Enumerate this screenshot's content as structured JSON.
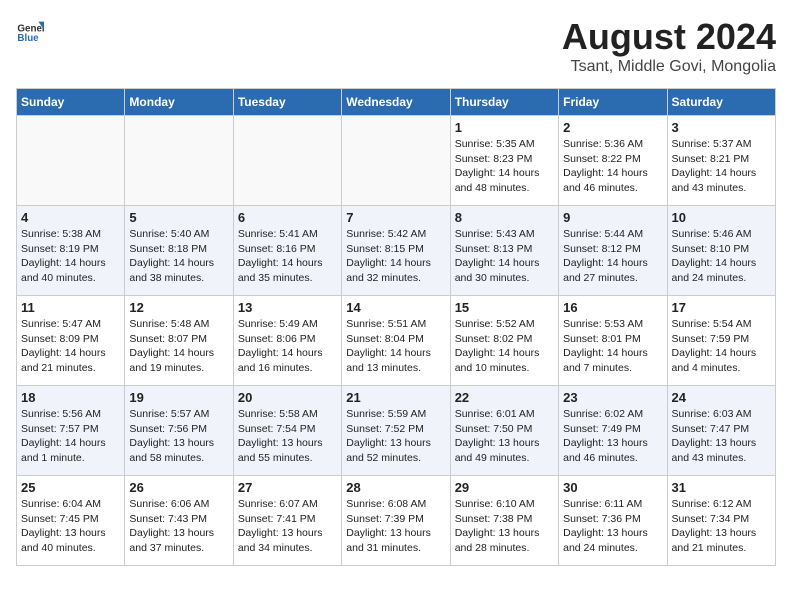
{
  "header": {
    "logo_general": "General",
    "logo_blue": "Blue",
    "month_title": "August 2024",
    "location": "Tsant, Middle Govi, Mongolia"
  },
  "days_of_week": [
    "Sunday",
    "Monday",
    "Tuesday",
    "Wednesday",
    "Thursday",
    "Friday",
    "Saturday"
  ],
  "weeks": [
    [
      {
        "day": "",
        "info": ""
      },
      {
        "day": "",
        "info": ""
      },
      {
        "day": "",
        "info": ""
      },
      {
        "day": "",
        "info": ""
      },
      {
        "day": "1",
        "info": "Sunrise: 5:35 AM\nSunset: 8:23 PM\nDaylight: 14 hours and 48 minutes."
      },
      {
        "day": "2",
        "info": "Sunrise: 5:36 AM\nSunset: 8:22 PM\nDaylight: 14 hours and 46 minutes."
      },
      {
        "day": "3",
        "info": "Sunrise: 5:37 AM\nSunset: 8:21 PM\nDaylight: 14 hours and 43 minutes."
      }
    ],
    [
      {
        "day": "4",
        "info": "Sunrise: 5:38 AM\nSunset: 8:19 PM\nDaylight: 14 hours and 40 minutes."
      },
      {
        "day": "5",
        "info": "Sunrise: 5:40 AM\nSunset: 8:18 PM\nDaylight: 14 hours and 38 minutes."
      },
      {
        "day": "6",
        "info": "Sunrise: 5:41 AM\nSunset: 8:16 PM\nDaylight: 14 hours and 35 minutes."
      },
      {
        "day": "7",
        "info": "Sunrise: 5:42 AM\nSunset: 8:15 PM\nDaylight: 14 hours and 32 minutes."
      },
      {
        "day": "8",
        "info": "Sunrise: 5:43 AM\nSunset: 8:13 PM\nDaylight: 14 hours and 30 minutes."
      },
      {
        "day": "9",
        "info": "Sunrise: 5:44 AM\nSunset: 8:12 PM\nDaylight: 14 hours and 27 minutes."
      },
      {
        "day": "10",
        "info": "Sunrise: 5:46 AM\nSunset: 8:10 PM\nDaylight: 14 hours and 24 minutes."
      }
    ],
    [
      {
        "day": "11",
        "info": "Sunrise: 5:47 AM\nSunset: 8:09 PM\nDaylight: 14 hours and 21 minutes."
      },
      {
        "day": "12",
        "info": "Sunrise: 5:48 AM\nSunset: 8:07 PM\nDaylight: 14 hours and 19 minutes."
      },
      {
        "day": "13",
        "info": "Sunrise: 5:49 AM\nSunset: 8:06 PM\nDaylight: 14 hours and 16 minutes."
      },
      {
        "day": "14",
        "info": "Sunrise: 5:51 AM\nSunset: 8:04 PM\nDaylight: 14 hours and 13 minutes."
      },
      {
        "day": "15",
        "info": "Sunrise: 5:52 AM\nSunset: 8:02 PM\nDaylight: 14 hours and 10 minutes."
      },
      {
        "day": "16",
        "info": "Sunrise: 5:53 AM\nSunset: 8:01 PM\nDaylight: 14 hours and 7 minutes."
      },
      {
        "day": "17",
        "info": "Sunrise: 5:54 AM\nSunset: 7:59 PM\nDaylight: 14 hours and 4 minutes."
      }
    ],
    [
      {
        "day": "18",
        "info": "Sunrise: 5:56 AM\nSunset: 7:57 PM\nDaylight: 14 hours and 1 minute."
      },
      {
        "day": "19",
        "info": "Sunrise: 5:57 AM\nSunset: 7:56 PM\nDaylight: 13 hours and 58 minutes."
      },
      {
        "day": "20",
        "info": "Sunrise: 5:58 AM\nSunset: 7:54 PM\nDaylight: 13 hours and 55 minutes."
      },
      {
        "day": "21",
        "info": "Sunrise: 5:59 AM\nSunset: 7:52 PM\nDaylight: 13 hours and 52 minutes."
      },
      {
        "day": "22",
        "info": "Sunrise: 6:01 AM\nSunset: 7:50 PM\nDaylight: 13 hours and 49 minutes."
      },
      {
        "day": "23",
        "info": "Sunrise: 6:02 AM\nSunset: 7:49 PM\nDaylight: 13 hours and 46 minutes."
      },
      {
        "day": "24",
        "info": "Sunrise: 6:03 AM\nSunset: 7:47 PM\nDaylight: 13 hours and 43 minutes."
      }
    ],
    [
      {
        "day": "25",
        "info": "Sunrise: 6:04 AM\nSunset: 7:45 PM\nDaylight: 13 hours and 40 minutes."
      },
      {
        "day": "26",
        "info": "Sunrise: 6:06 AM\nSunset: 7:43 PM\nDaylight: 13 hours and 37 minutes."
      },
      {
        "day": "27",
        "info": "Sunrise: 6:07 AM\nSunset: 7:41 PM\nDaylight: 13 hours and 34 minutes."
      },
      {
        "day": "28",
        "info": "Sunrise: 6:08 AM\nSunset: 7:39 PM\nDaylight: 13 hours and 31 minutes."
      },
      {
        "day": "29",
        "info": "Sunrise: 6:10 AM\nSunset: 7:38 PM\nDaylight: 13 hours and 28 minutes."
      },
      {
        "day": "30",
        "info": "Sunrise: 6:11 AM\nSunset: 7:36 PM\nDaylight: 13 hours and 24 minutes."
      },
      {
        "day": "31",
        "info": "Sunrise: 6:12 AM\nSunset: 7:34 PM\nDaylight: 13 hours and 21 minutes."
      }
    ]
  ]
}
